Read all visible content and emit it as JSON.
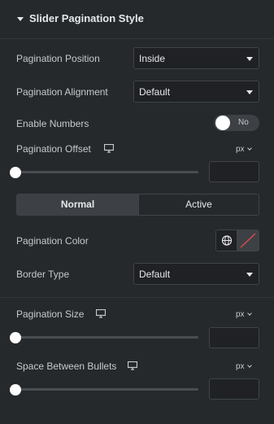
{
  "section": {
    "title": "Slider Pagination Style"
  },
  "pagination_position": {
    "label": "Pagination Position",
    "value": "Inside"
  },
  "pagination_alignment": {
    "label": "Pagination Alignment",
    "value": "Default"
  },
  "enable_numbers": {
    "label": "Enable Numbers",
    "toggle_text": "No",
    "on": false
  },
  "pagination_offset": {
    "label": "Pagination Offset",
    "unit": "px",
    "value": ""
  },
  "tabs": {
    "normal": "Normal",
    "active": "Active",
    "selected": "Normal"
  },
  "pagination_color": {
    "label": "Pagination Color"
  },
  "border_type": {
    "label": "Border Type",
    "value": "Default"
  },
  "pagination_size": {
    "label": "Pagination Size",
    "unit": "px",
    "value": ""
  },
  "space_between_bullets": {
    "label": "Space Between Bullets",
    "unit": "px",
    "value": ""
  },
  "colors": {
    "accent_red": "#e34c4c",
    "background": "#26292c"
  },
  "icons": {
    "section_toggle": "caret-down-icon",
    "responsive": "desktop-icon",
    "global": "globe-icon",
    "no_color": "slash-icon"
  }
}
